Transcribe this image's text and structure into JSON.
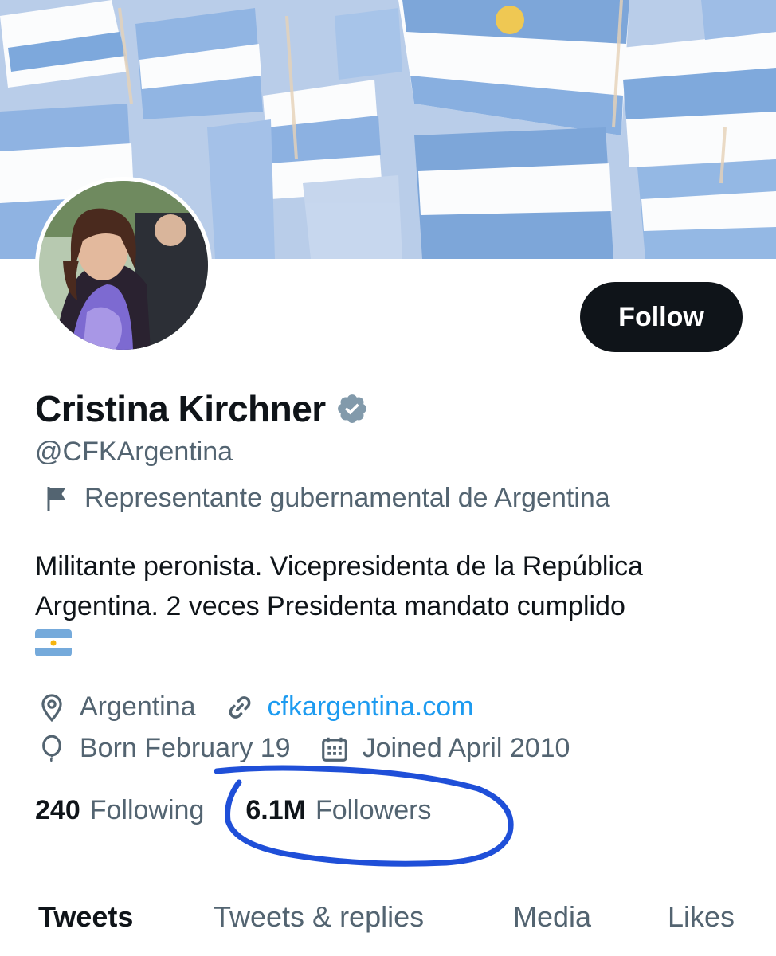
{
  "profile": {
    "name": "Cristina Kirchner",
    "handle": "@CFKArgentina",
    "label": "Representante gubernamental de Argentina",
    "bio_line1": "Militante peronista. Vicepresidenta de la República",
    "bio_line2": "Argentina. 2 veces Presidenta mandato cumplido",
    "location": "Argentina",
    "website": "cfkargentina.com",
    "birthday": "Born February 19",
    "joined": "Joined April 2010"
  },
  "actions": {
    "follow_label": "Follow"
  },
  "stats": {
    "following_count": "240",
    "following_label": "Following",
    "followers_count": "6.1M",
    "followers_label": "Followers"
  },
  "tabs": [
    {
      "label": "Tweets",
      "active": true
    },
    {
      "label": "Tweets & replies",
      "active": false
    },
    {
      "label": "Media",
      "active": false
    },
    {
      "label": "Likes",
      "active": false
    }
  ],
  "icons": {
    "verified": "verified-badge-icon",
    "label_flag": "flag-icon",
    "location": "location-pin-icon",
    "link": "link-icon",
    "birthday": "balloon-icon",
    "calendar": "calendar-icon",
    "emoji": "argentina-flag-emoji"
  },
  "colors": {
    "button_bg": "#0f1419",
    "link": "#1d9bf0",
    "secondary_text": "#536471",
    "annotation": "#1f4fd8",
    "verified_badge": "#829aab"
  }
}
